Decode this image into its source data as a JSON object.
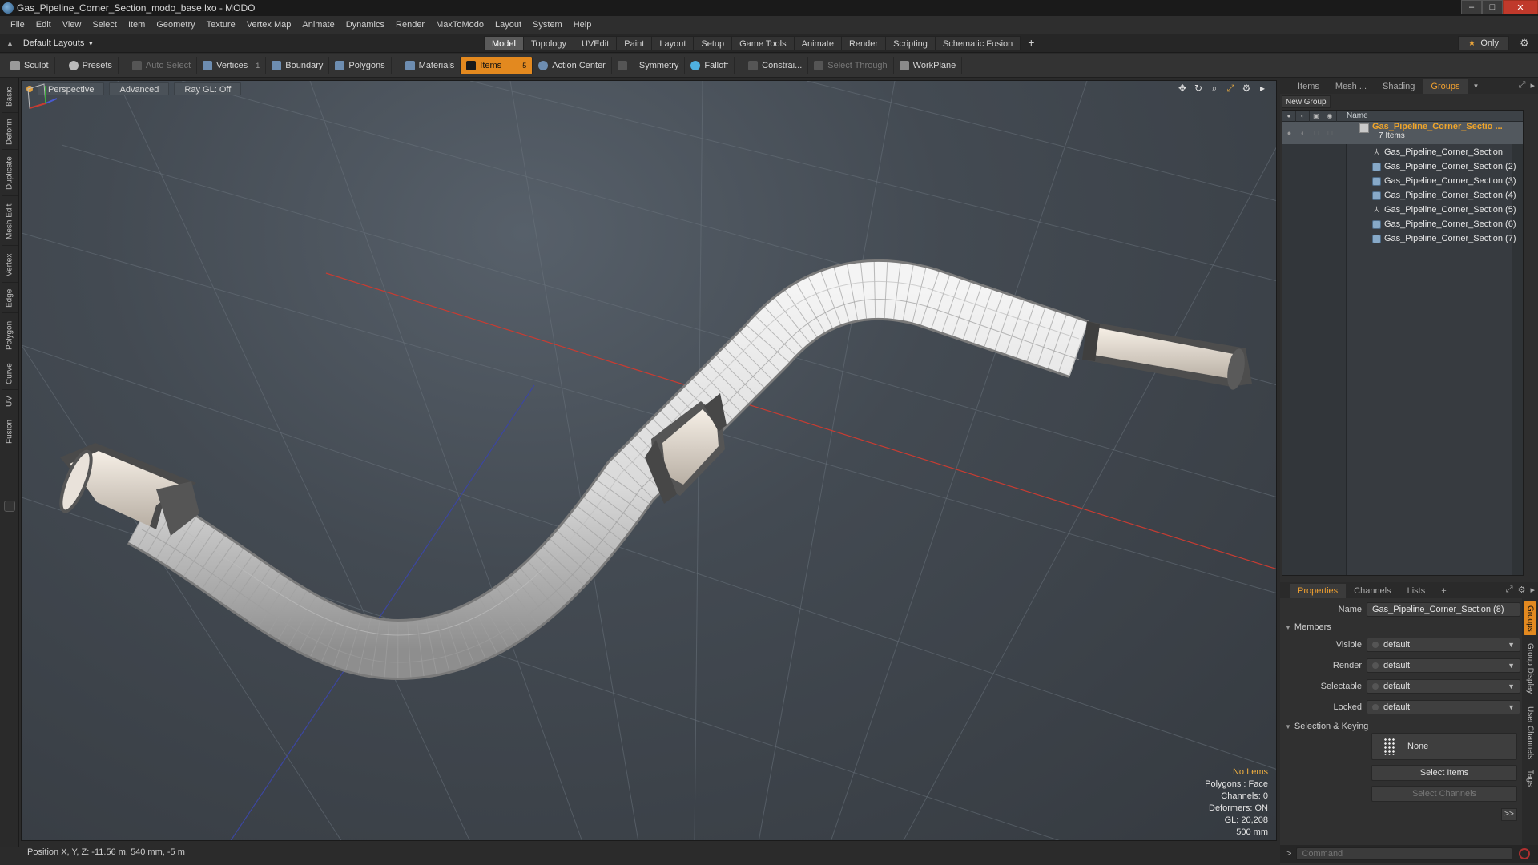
{
  "window": {
    "title": "Gas_Pipeline_Corner_Section_modo_base.lxo - MODO",
    "controls": [
      "–",
      "□",
      "✕"
    ]
  },
  "menu": [
    "File",
    "Edit",
    "View",
    "Select",
    "Item",
    "Geometry",
    "Texture",
    "Vertex Map",
    "Animate",
    "Dynamics",
    "Render",
    "MaxToModo",
    "Layout",
    "System",
    "Help"
  ],
  "layoutbar": {
    "layout_name": "Default Layouts",
    "tabs": [
      "Model",
      "Topology",
      "UVEdit",
      "Paint",
      "Layout",
      "Setup",
      "Game Tools",
      "Animate",
      "Render",
      "Scripting",
      "Schematic Fusion"
    ],
    "active_tab": "Model",
    "only_label": "Only",
    "plus": "+"
  },
  "toolbar": {
    "sculpt": "Sculpt",
    "presets": "Presets",
    "auto_select": "Auto Select",
    "vertices": "Vertices",
    "vertices_count": "1",
    "boundary": "Boundary",
    "polygons": "Polygons",
    "materials": "Materials",
    "items": "Items",
    "items_count": "5",
    "action_center": "Action Center",
    "symmetry": "Symmetry",
    "falloff": "Falloff",
    "constrain": "Constrai...",
    "select_through": "Select Through",
    "workplane": "WorkPlane"
  },
  "left_tabs": [
    "Basic",
    "Deform",
    "Duplicate",
    "Mesh Edit",
    "Vertex",
    "Edge",
    "Polygon",
    "Curve",
    "UV",
    "Fusion"
  ],
  "viewport": {
    "view_mode": "Perspective",
    "advanced": "Advanced",
    "ray_gl": "Ray GL: Off",
    "info": {
      "no_items": "No Items",
      "polygons": "Polygons : Face",
      "channels": "Channels: 0",
      "deformers": "Deformers: ON",
      "gl": "GL: 20,208",
      "scale": "500 mm"
    }
  },
  "status": {
    "position": "Position X, Y, Z:  -11.56 m, 540 mm, -5 m"
  },
  "groups_panel": {
    "tabs": [
      "Items",
      "Mesh ...",
      "Shading",
      "Groups"
    ],
    "active_tab": "Groups",
    "new_group": "New Group",
    "name_col": "Name",
    "group_name": "Gas_Pipeline_Corner_Sectio ...",
    "group_count": "7 Items",
    "children": [
      {
        "name": "Gas_Pipeline_Corner_Section",
        "icon": "locator-icon"
      },
      {
        "name": "Gas_Pipeline_Corner_Section (2)",
        "icon": "mesh-icon"
      },
      {
        "name": "Gas_Pipeline_Corner_Section (3)",
        "icon": "mesh-icon"
      },
      {
        "name": "Gas_Pipeline_Corner_Section (4)",
        "icon": "mesh-icon"
      },
      {
        "name": "Gas_Pipeline_Corner_Section (5)",
        "icon": "locator-icon"
      },
      {
        "name": "Gas_Pipeline_Corner_Section (6)",
        "icon": "mesh-icon"
      },
      {
        "name": "Gas_Pipeline_Corner_Section (7)",
        "icon": "mesh-icon"
      }
    ]
  },
  "properties_panel": {
    "tabs": [
      "Properties",
      "Channels",
      "Lists"
    ],
    "active_tab": "Properties",
    "plus": "+",
    "name_label": "Name",
    "name_value": "Gas_Pipeline_Corner_Section (8)",
    "members_label": "Members",
    "visible_label": "Visible",
    "visible_value": "default",
    "render_label": "Render",
    "render_value": "default",
    "selectable_label": "Selectable",
    "selectable_value": "default",
    "locked_label": "Locked",
    "locked_value": "default",
    "selection_keying_label": "Selection & Keying",
    "none_label": "None",
    "select_items": "Select Items",
    "select_channels": "Select Channels",
    "more": ">>",
    "vertical_tabs": [
      "Groups",
      "Group Display",
      "User Channels",
      "Tags"
    ]
  },
  "command": {
    "placeholder": "Command"
  },
  "colors": {
    "accent": "#e3891f",
    "group_name": "#f0a52a",
    "viewport_bg": "#434a52",
    "x_axis": "#c83c32",
    "z_axis": "#3c46a0"
  }
}
